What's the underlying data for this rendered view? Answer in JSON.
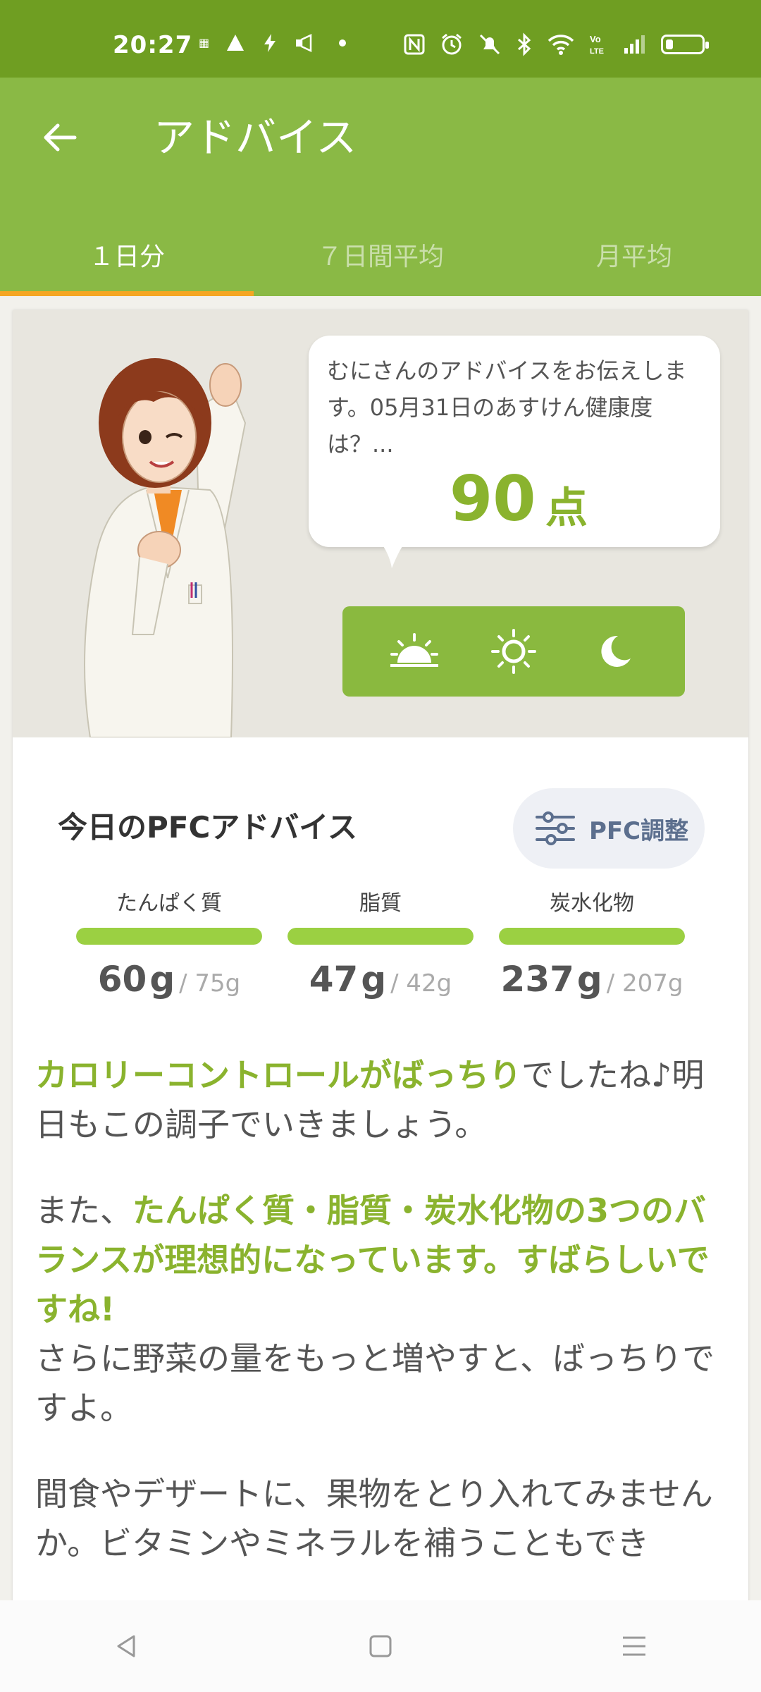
{
  "status_bar": {
    "time": "20:27",
    "left_icons": [
      "temu-icon",
      "app-icon",
      "bolt-icon",
      "megaphone-icon",
      "dot-icon"
    ],
    "right_icons": [
      "nfc-icon",
      "alarm-icon",
      "mute-icon",
      "bluetooth-icon",
      "wifi-icon",
      "volte-icon",
      "signal-icon",
      "battery-icon"
    ],
    "battery_level": 0.2
  },
  "app_bar": {
    "title": "アドバイス",
    "back_icon": "arrow-left-icon"
  },
  "tabs": [
    {
      "label": "１日分",
      "active": true
    },
    {
      "label": "７日間平均",
      "active": false
    },
    {
      "label": "月平均",
      "active": false
    }
  ],
  "advice_bubble": {
    "text": "むにさんのアドバイスをお伝えします。05月31日のあすけん健康度は？...",
    "score": "90",
    "score_unit": "点"
  },
  "meal_time_buttons": [
    {
      "icon": "sunrise-icon"
    },
    {
      "icon": "sun-icon"
    },
    {
      "icon": "moon-icon"
    }
  ],
  "pfc": {
    "title": "今日のPFCアドバイス",
    "adjust_label": "PFC調整",
    "nutrients": [
      {
        "name": "たんぱく質",
        "value": "60",
        "unit": "g",
        "target": "/ 75g",
        "fill": 1.0
      },
      {
        "name": "脂質",
        "value": "47",
        "unit": "g",
        "target": "/ 42g",
        "fill": 1.0
      },
      {
        "name": "炭水化物",
        "value": "237",
        "unit": "g",
        "target": "/ 207g",
        "fill": 1.0
      }
    ]
  },
  "advice_paragraphs": [
    {
      "hl1": "カロリーコントロールがばっちり",
      "t1": "でしたね♪明日もこの調子でいきましょう。",
      "hl2": "",
      "t2": ""
    },
    {
      "hl1": "",
      "t1": "また、",
      "hl2": "たんぱく質・脂質・炭水化物の3つのバランスが理想的になっています。すばらしいですね!",
      "t2": "さらに野菜の量をもっと増やすと、ばっちりですよ。"
    },
    {
      "hl1": "",
      "t1": "間食やデザートに、果物をとり入れてみませんか。ビタミンやミネラルを補うこともでき",
      "hl2": "",
      "t2": ""
    }
  ],
  "nav_bar": {
    "buttons": [
      "back-triangle-icon",
      "home-square-icon",
      "menu-lines-icon"
    ]
  },
  "colors": {
    "status_bar": "#6f9e22",
    "app_bar": "#8ab945",
    "tab_indicator": "#f5a623",
    "accent_text": "#8ab32e",
    "nutrient_bar": "#9bd042"
  }
}
